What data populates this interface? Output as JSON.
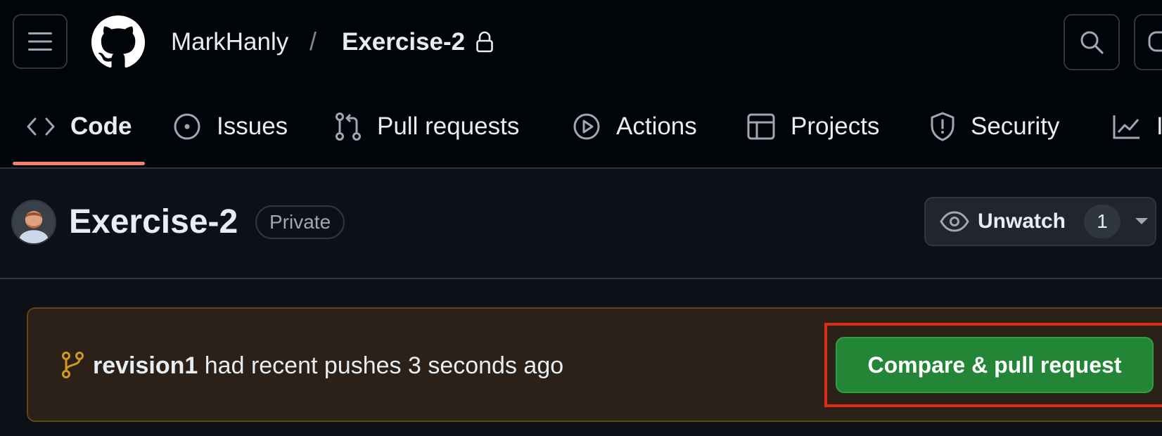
{
  "header": {
    "owner": "MarkHanly",
    "separator": "/",
    "repo": "Exercise-2"
  },
  "nav": {
    "tabs": [
      {
        "label": "Code",
        "icon": "code-icon",
        "selected": true
      },
      {
        "label": "Issues",
        "icon": "issue-icon",
        "selected": false
      },
      {
        "label": "Pull requests",
        "icon": "pull-request-icon",
        "selected": false
      },
      {
        "label": "Actions",
        "icon": "play-icon",
        "selected": false
      },
      {
        "label": "Projects",
        "icon": "table-icon",
        "selected": false
      },
      {
        "label": "Security",
        "icon": "shield-icon",
        "selected": false
      },
      {
        "label": "I",
        "icon": "graph-icon",
        "selected": false
      }
    ]
  },
  "repo_header": {
    "title": "Exercise-2",
    "visibility": "Private",
    "watch_label": "Unwatch",
    "watch_count": "1"
  },
  "banner": {
    "branch": "revision1",
    "message": "had recent pushes 3 seconds ago",
    "button_label": "Compare & pull request"
  },
  "colors": {
    "accent_underline": "#f78166",
    "primary_button": "#238636",
    "highlight_box": "#e02d12",
    "banner_bg": "#2b2118"
  }
}
